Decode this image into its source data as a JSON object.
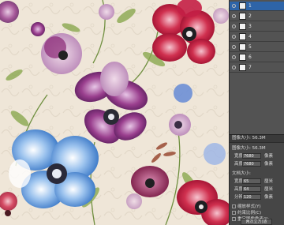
{
  "layers": {
    "rows": [
      {
        "name": "1",
        "active": true
      },
      {
        "name": "2",
        "active": false
      },
      {
        "name": "3",
        "active": false
      },
      {
        "name": "4",
        "active": false
      },
      {
        "name": "5",
        "active": false
      },
      {
        "name": "6",
        "active": false
      },
      {
        "name": "7",
        "active": false
      }
    ]
  },
  "dialog": {
    "title": "图像大小: 56.3M",
    "size_label": "图像大小: 56.3M",
    "width_label": "宽度:",
    "width_value": "7680",
    "width_unit": "像素",
    "height_label": "高度:",
    "height_value": "7680",
    "height_unit": "像素",
    "doc_size_label": "文档大小:",
    "doc_width_label": "宽度(D):",
    "doc_width_value": "65",
    "doc_width_unit": "厘米",
    "doc_height_label": "高度(G):",
    "doc_height_value": "64",
    "doc_height_unit": "厘米",
    "resolution_label": "分辨率(R):",
    "resolution_value": "120",
    "resolution_unit": "像素",
    "scale_styles_label": "缩放样式(Y)",
    "constrain_label": "约束比例(C)",
    "resample_label": "重定图像像素(I):",
    "resample_value": "两次立方(适"
  },
  "colors": {
    "canvas_bg": "#efe6d8",
    "panel_bg": "#535353",
    "dialog_bg": "#464646",
    "selected_layer": "#2e64a8"
  }
}
